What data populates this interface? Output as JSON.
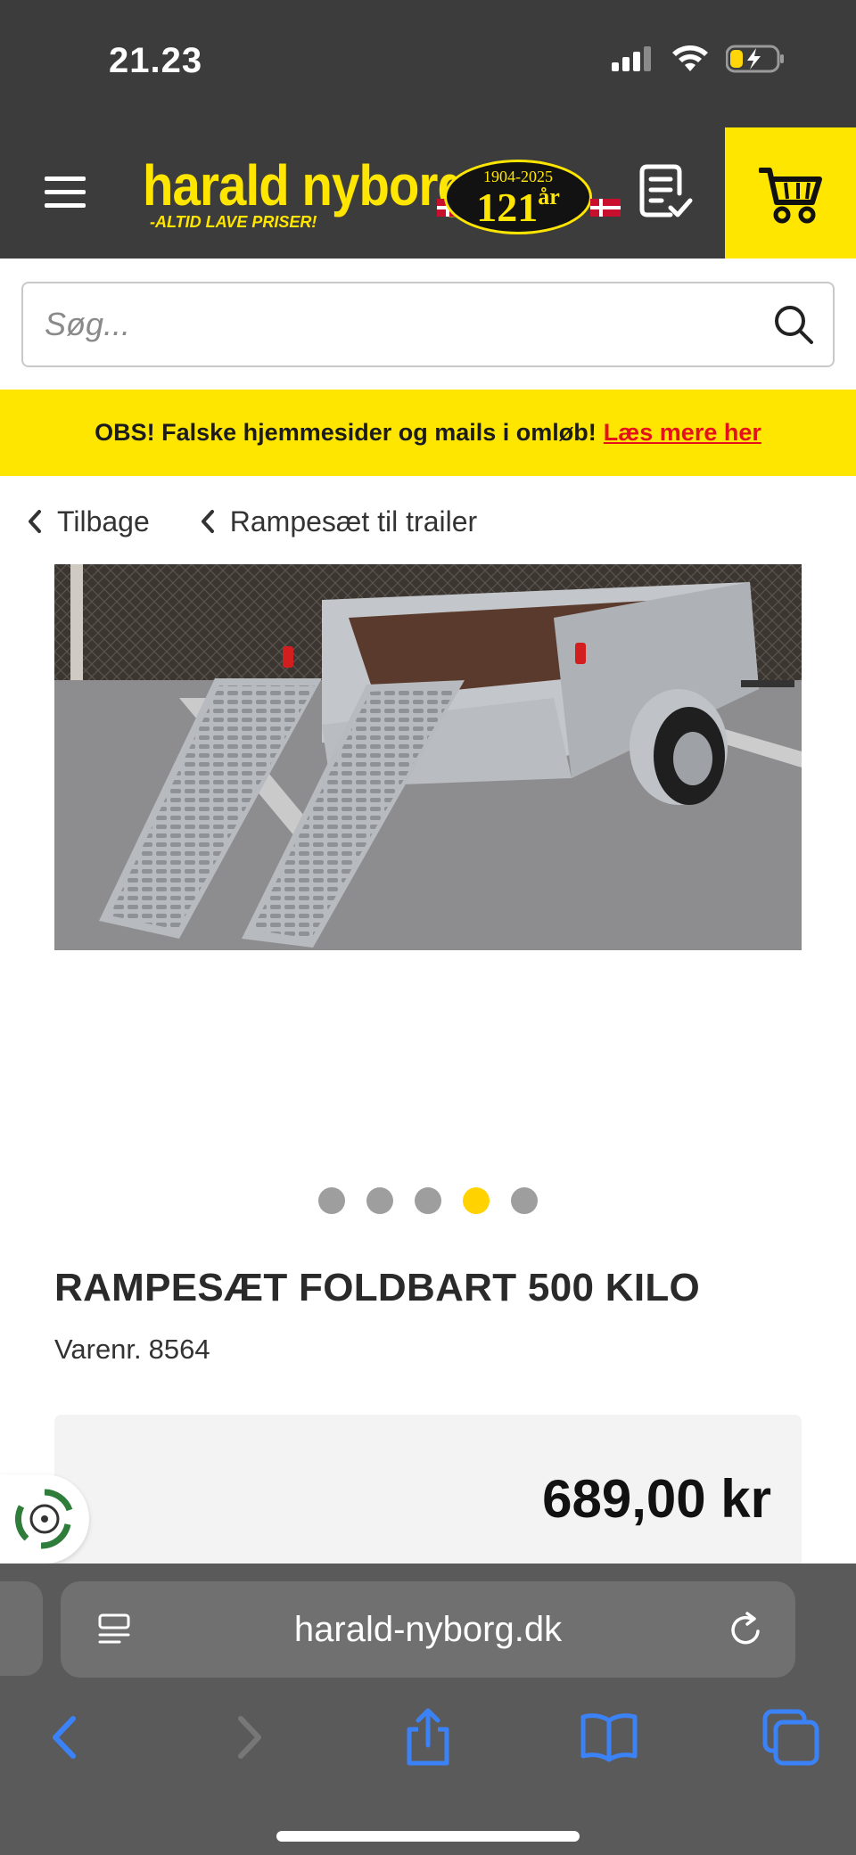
{
  "status_bar": {
    "time": "21.23"
  },
  "header": {
    "logo_text": "harald nyborg",
    "logo_tagline": "-ALTID LAVE PRISER!",
    "badge_years": "1904-2025",
    "badge_number": "121",
    "badge_suffix": "år"
  },
  "search": {
    "placeholder": "Søg..."
  },
  "notice": {
    "text": "OBS! Falske hjemmesider og mails i omløb!",
    "link": "Læs mere her"
  },
  "breadcrumbs": [
    {
      "label": "Tilbage"
    },
    {
      "label": "Rampesæt til trailer"
    }
  ],
  "carousel": {
    "count": 5,
    "active_index": 3
  },
  "product": {
    "title": "RAMPESÆT FOLDBART 500 KILO",
    "sku_label": "Varenr.",
    "sku": "8564",
    "price": "689,00 kr"
  },
  "browser": {
    "url": "harald-nyborg.dk"
  },
  "colors": {
    "brand_yellow": "#ffe600",
    "header_dark": "#3c3c3c",
    "link_red": "#e4101a",
    "ios_blue": "#3b82f6"
  }
}
